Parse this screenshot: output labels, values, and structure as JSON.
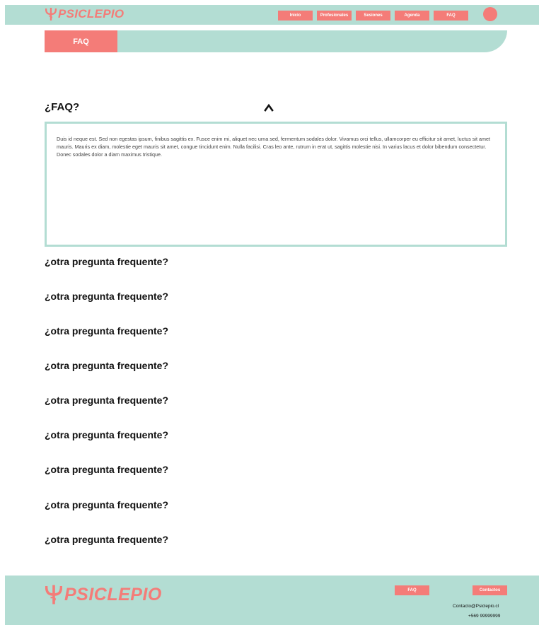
{
  "brand": {
    "name": "PSICLEPIO",
    "color": "#f47c78",
    "accent_bg": "#b3ddd3"
  },
  "header": {
    "nav": [
      "Inicio",
      "Profesionales",
      "Sesiones",
      "Agenda",
      "FAQ"
    ],
    "avatar_icon": "avatar-circle"
  },
  "banner": {
    "tab_label": "FAQ"
  },
  "faq": {
    "title": "¿FAQ?",
    "toggle_icon": "caret-up-icon",
    "answer": "Duis id neque est. Sed non egestas ipsum, finibus sagittis ex. Fusce enim mi, aliquet nec urna sed, fermentum sodales dolor. Vivamus orci tellus, ullamcorper eu efficitur sit amet, luctus sit amet mauris. Mauris ex diam, molestie eget mauris sit amet, congue tincidunt enim. Nulla facilisi. Cras leo ante, rutrum in erat ut, sagittis molestie nisi. In varius lacus et dolor bibendum consectetur. Donec sodales dolor a diam maximus tristique.",
    "questions": [
      "¿otra pregunta frequente?",
      "¿otra pregunta frequente?",
      "¿otra pregunta frequente?",
      "¿otra pregunta frequente?",
      "¿otra pregunta frequente?",
      "¿otra pregunta frequente?",
      "¿otra pregunta frequente?",
      "¿otra pregunta frequente?",
      "¿otra pregunta frequente?"
    ]
  },
  "footer": {
    "faq_label": "FAQ",
    "contact_label": "Contactos",
    "email": "Contacto@Psiclepio.cl",
    "phone": "+569 99999999"
  }
}
